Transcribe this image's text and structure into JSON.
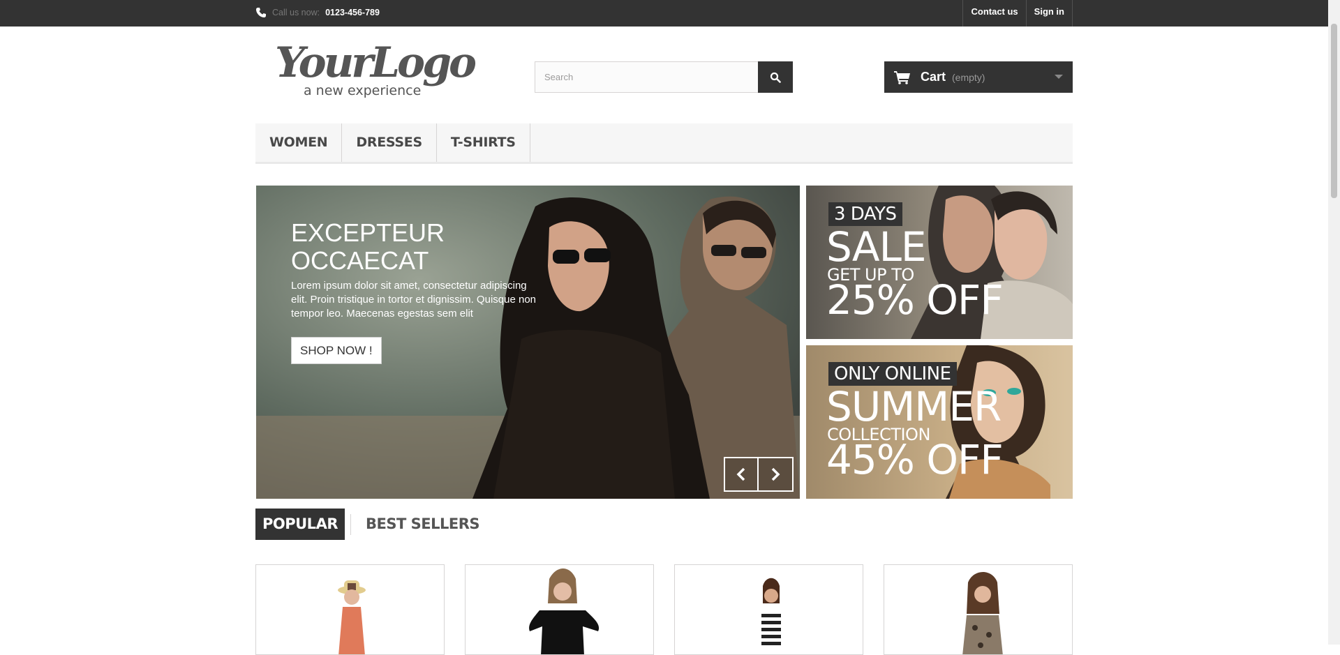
{
  "topbar": {
    "call_prefix": "Call us now:",
    "phone": "0123-456-789",
    "contact_label": "Contact us",
    "signin_label": "Sign in"
  },
  "logo": {
    "main": "YourLogo",
    "tagline": "a new experience"
  },
  "search": {
    "placeholder": "Search"
  },
  "cart": {
    "label": "Cart",
    "status": "(empty)"
  },
  "nav": {
    "items": [
      "WOMEN",
      "DRESSES",
      "T-SHIRTS"
    ]
  },
  "slider": {
    "heading": "EXCEPTEUR OCCAECAT",
    "description": "Lorem ipsum dolor sit amet, consectetur adipiscing elit. Proin tristique in tortor et dignissim. Quisque non tempor leo. Maecenas egestas sem elit",
    "button_label": "SHOP NOW !"
  },
  "banners": [
    {
      "tag": "3 DAYS",
      "big": "SALE",
      "mid": "GET UP TO",
      "off": "25% OFF"
    },
    {
      "tag": "ONLY ONLINE",
      "big": "SUMMER",
      "mid": "COLLECTION",
      "off": "45% OFF"
    }
  ],
  "tabs": {
    "active": "POPULAR",
    "inactive": "BEST SELLERS"
  },
  "colors": {
    "dark": "#333333",
    "nav_bg": "#f6f6f6",
    "border": "#d6d4d4"
  },
  "icons": [
    "phone-icon",
    "search-icon",
    "cart-icon",
    "chevron-down-icon",
    "chevron-left-icon",
    "chevron-right-icon"
  ]
}
